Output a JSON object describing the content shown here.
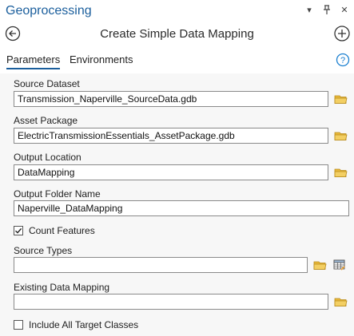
{
  "pane": {
    "title": "Geoprocessing",
    "controls": [
      "chevron-down-icon",
      "pin-icon",
      "close-icon"
    ]
  },
  "tool": {
    "title": "Create Simple Data Mapping"
  },
  "tabs": [
    {
      "label": "Parameters",
      "active": true
    },
    {
      "label": "Environments",
      "active": false
    }
  ],
  "params": {
    "source_dataset": {
      "label": "Source Dataset",
      "value": "Transmission_Naperville_SourceData.gdb"
    },
    "asset_package": {
      "label": "Asset Package",
      "value": "ElectricTransmissionEssentials_AssetPackage.gdb"
    },
    "output_location": {
      "label": "Output Location",
      "value": "DataMapping"
    },
    "output_folder_name": {
      "label": "Output Folder Name",
      "value": "Naperville_DataMapping"
    },
    "count_features": {
      "label": "Count Features",
      "checked": true
    },
    "source_types": {
      "label": "Source Types",
      "value": ""
    },
    "existing_data_mapping": {
      "label": "Existing Data Mapping",
      "value": ""
    },
    "include_all_target_classes": {
      "label": "Include All Target Classes",
      "checked": false
    }
  },
  "colors": {
    "accent": "#1a5e9c",
    "folder": "#e8b83a",
    "field_border": "#8a8a8a",
    "form_bg": "#f7f7f7"
  }
}
